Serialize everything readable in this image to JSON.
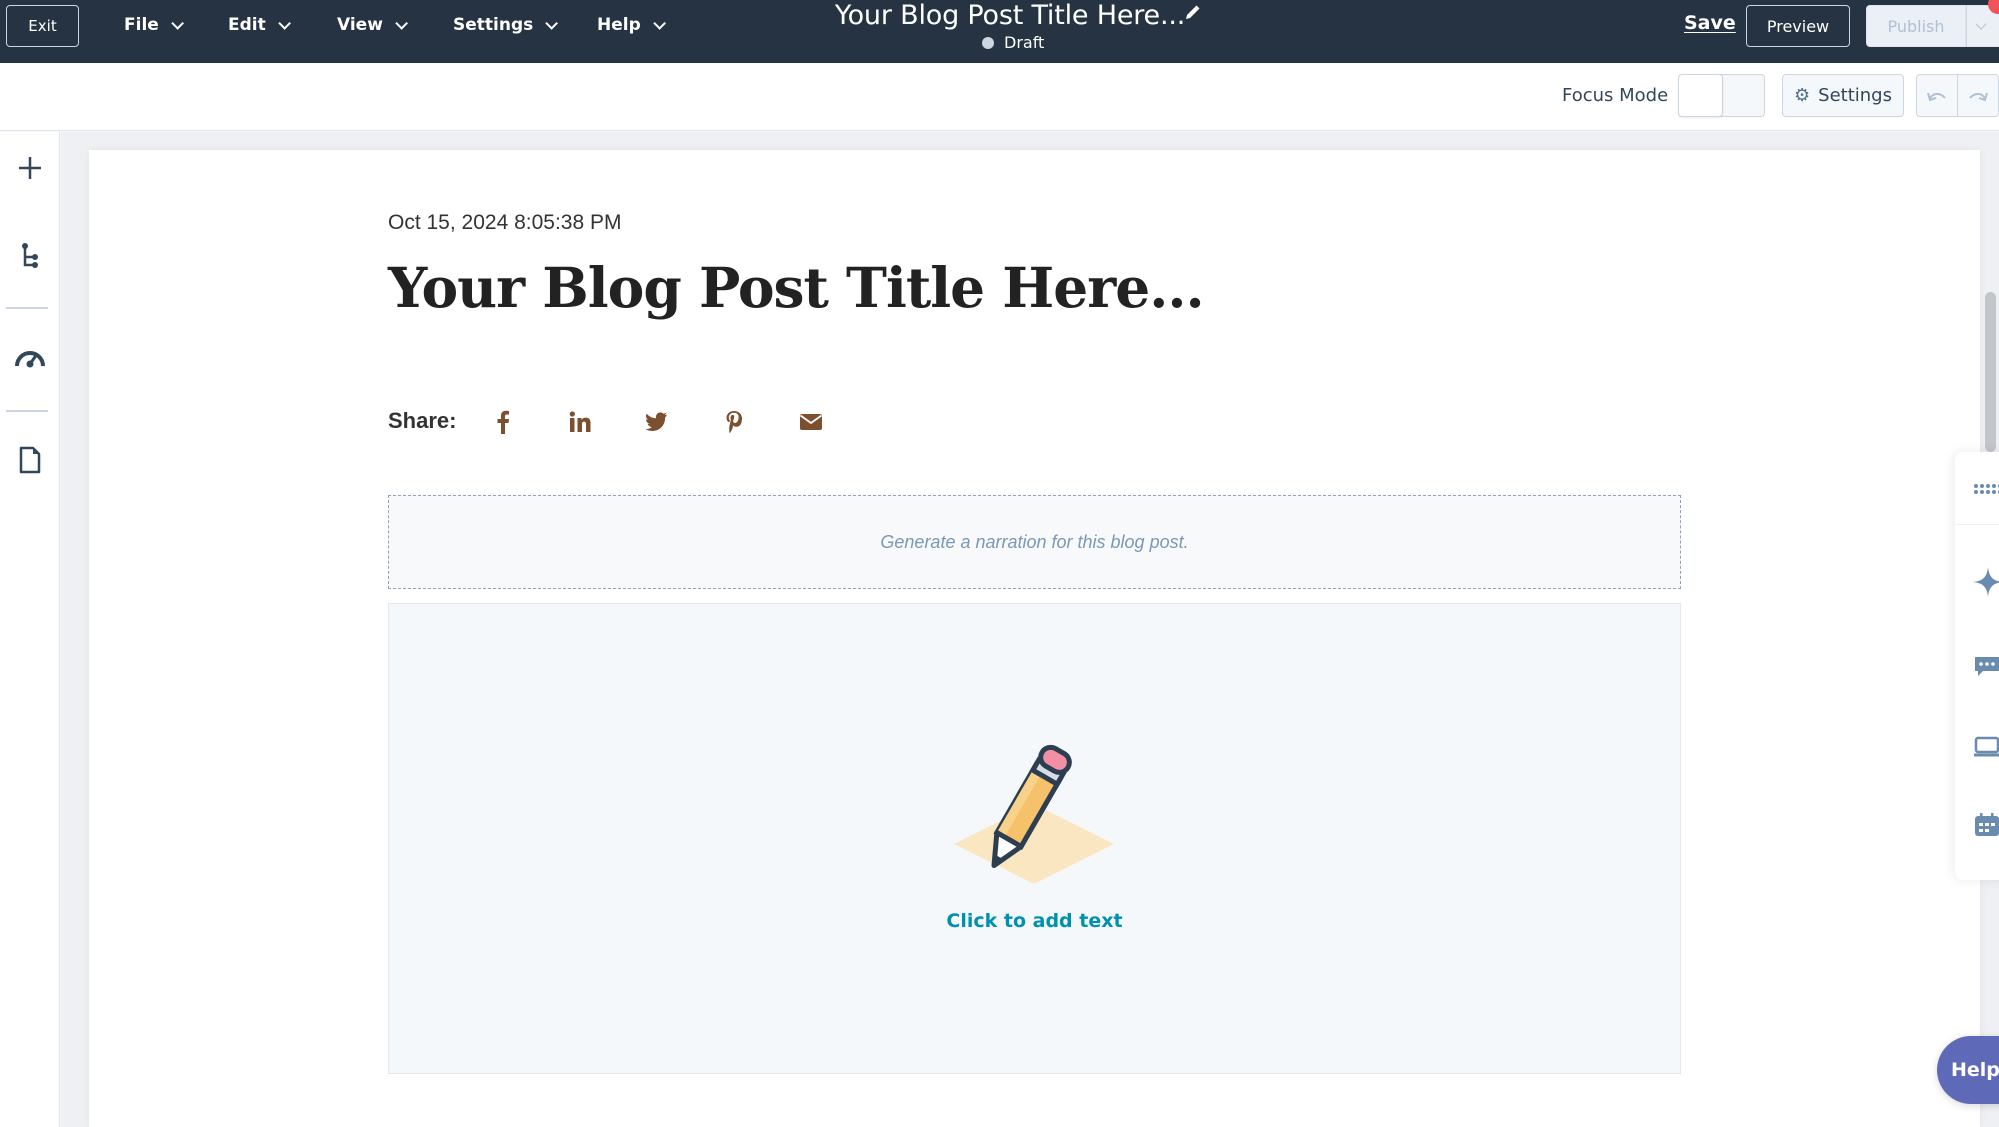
{
  "header": {
    "exit_label": "Exit",
    "menus": [
      {
        "label": "File"
      },
      {
        "label": "Edit"
      },
      {
        "label": "View"
      },
      {
        "label": "Settings"
      },
      {
        "label": "Help"
      }
    ],
    "doc_title": "Your Blog Post Title Here...",
    "status": "Draft",
    "save_label": "Save",
    "preview_label": "Preview",
    "publish_label": "Publish"
  },
  "toolbar": {
    "focus_mode_label": "Focus Mode",
    "focus_mode_on": false,
    "settings_label": "Settings"
  },
  "sidebar": {
    "items": [
      {
        "icon": "plus-icon",
        "label": "Add"
      },
      {
        "icon": "tree-icon",
        "label": "Contents"
      },
      {
        "icon": "gauge-icon",
        "label": "Optimize"
      },
      {
        "icon": "file-icon",
        "label": "Pages"
      }
    ]
  },
  "post": {
    "date": "Oct 15, 2024 8:05:38 PM",
    "title": "Your Blog Post Title Here...",
    "share_label": "Share:",
    "share_icons": [
      "facebook-icon",
      "linkedin-icon",
      "twitter-icon",
      "pinterest-icon",
      "email-icon"
    ],
    "narration_text": "Generate a narration for this blog post.",
    "add_text_label": "Click to add text"
  },
  "right_rail": {
    "icons": [
      "apps-icon",
      "sparkle-icon",
      "chat-icon",
      "laptop-icon",
      "calendar-icon"
    ]
  },
  "help_label": "Help",
  "colors": {
    "header_bg": "#253342",
    "share_icon": "#7c4f2f",
    "link_teal": "#0091ae",
    "help_bg": "#5e6ab8",
    "rail_icon": "#6a8bb0"
  }
}
